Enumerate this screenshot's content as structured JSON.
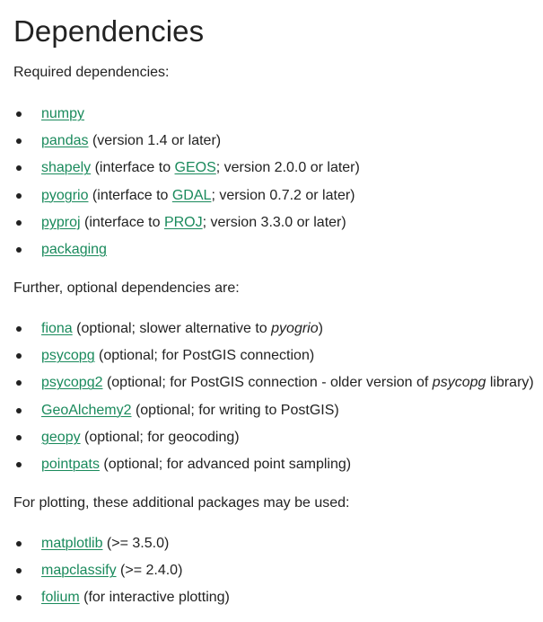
{
  "heading": "Dependencies",
  "required": {
    "intro": "Required dependencies:",
    "items": [
      {
        "pkg": "numpy",
        "pre": "",
        "link2": "",
        "post": ""
      },
      {
        "pkg": "pandas",
        "pre": " (version 1.4 or later)",
        "link2": "",
        "post": ""
      },
      {
        "pkg": "shapely",
        "pre": " (interface to ",
        "link2": "GEOS",
        "post": "; version 2.0.0 or later)"
      },
      {
        "pkg": "pyogrio",
        "pre": " (interface to ",
        "link2": "GDAL",
        "post": "; version 0.7.2 or later)"
      },
      {
        "pkg": "pyproj",
        "pre": " (interface to ",
        "link2": "PROJ",
        "post": "; version 3.3.0 or later)"
      },
      {
        "pkg": "packaging",
        "pre": "",
        "link2": "",
        "post": ""
      }
    ]
  },
  "optional": {
    "intro": "Further, optional dependencies are:",
    "items": [
      {
        "pkg": "fiona",
        "pre": " (optional; slower alternative to ",
        "em": "pyogrio",
        "post": ")"
      },
      {
        "pkg": "psycopg",
        "pre": " (optional; for PostGIS connection)",
        "em": "",
        "post": ""
      },
      {
        "pkg": "psycopg2",
        "pre": " (optional; for PostGIS connection - older version of ",
        "em": "psycopg",
        "post": " library)"
      },
      {
        "pkg": "GeoAlchemy2",
        "pre": " (optional; for writing to PostGIS)",
        "em": "",
        "post": ""
      },
      {
        "pkg": "geopy",
        "pre": " (optional; for geocoding)",
        "em": "",
        "post": ""
      },
      {
        "pkg": "pointpats",
        "pre": " (optional; for advanced point sampling)",
        "em": "",
        "post": ""
      }
    ]
  },
  "plotting": {
    "intro": "For plotting, these additional packages may be used:",
    "items": [
      {
        "pkg": "matplotlib",
        "pre": " (>= 3.5.0)"
      },
      {
        "pkg": "mapclassify",
        "pre": " (>= 2.4.0)"
      },
      {
        "pkg": "folium",
        "pre": " (for interactive plotting)"
      }
    ]
  },
  "colors": {
    "link": "#1a8a5c",
    "text": "#222222"
  }
}
